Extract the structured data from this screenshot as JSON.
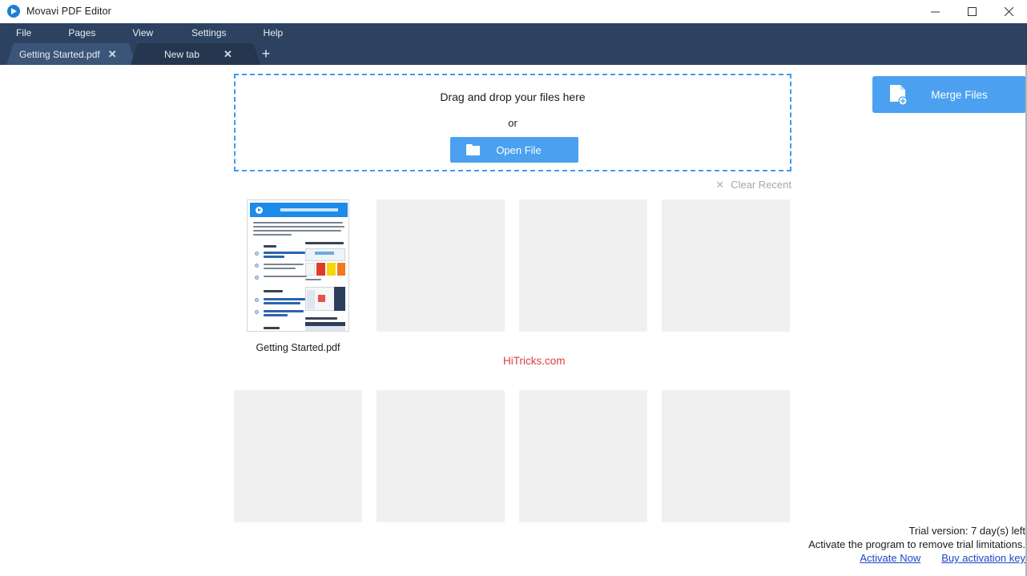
{
  "window": {
    "title": "Movavi PDF Editor",
    "logo_icon": "movavi-logo-icon",
    "controls": {
      "minimize": "minimize-icon",
      "maximize": "maximize-icon",
      "close": "close-icon"
    }
  },
  "menubar": {
    "items": [
      {
        "label": "File"
      },
      {
        "label": "Pages"
      },
      {
        "label": "View"
      },
      {
        "label": "Settings"
      },
      {
        "label": "Help"
      }
    ]
  },
  "tabs": {
    "items": [
      {
        "label": "Getting Started.pdf",
        "close_icon": "close-icon",
        "active": true
      },
      {
        "label": "New tab",
        "close_icon": "close-icon",
        "active": false
      }
    ],
    "add_tab_icon": "plus-icon"
  },
  "dropzone": {
    "title": "Drag and drop your files here",
    "or": "or",
    "open_file_label": "Open File",
    "open_file_icon": "folder-icon"
  },
  "merge": {
    "label": "Merge Files",
    "icon": "document-plus-icon"
  },
  "recent": {
    "clear_label": "Clear Recent",
    "clear_icon": "close-icon",
    "tiles": [
      {
        "name": "Getting Started.pdf",
        "empty": false
      },
      {
        "name": "",
        "empty": true
      },
      {
        "name": "",
        "empty": true
      },
      {
        "name": "",
        "empty": true
      },
      {
        "name": "",
        "empty": true
      },
      {
        "name": "",
        "empty": true
      },
      {
        "name": "",
        "empty": true
      },
      {
        "name": "",
        "empty": true
      }
    ]
  },
  "watermark": {
    "text": "HiTricks.com"
  },
  "trial": {
    "status": "Trial version: 7 day(s) left",
    "message": "Activate the program to remove trial limitations.",
    "activate_link": "Activate Now",
    "buy_link": "Buy activation key"
  },
  "colors": {
    "accent_blue": "#4ba1f0",
    "chrome_dark": "#2c4260",
    "link_blue": "#1a46c8",
    "watermark_red": "#d94040",
    "tile_gray": "#f0f0f0"
  }
}
